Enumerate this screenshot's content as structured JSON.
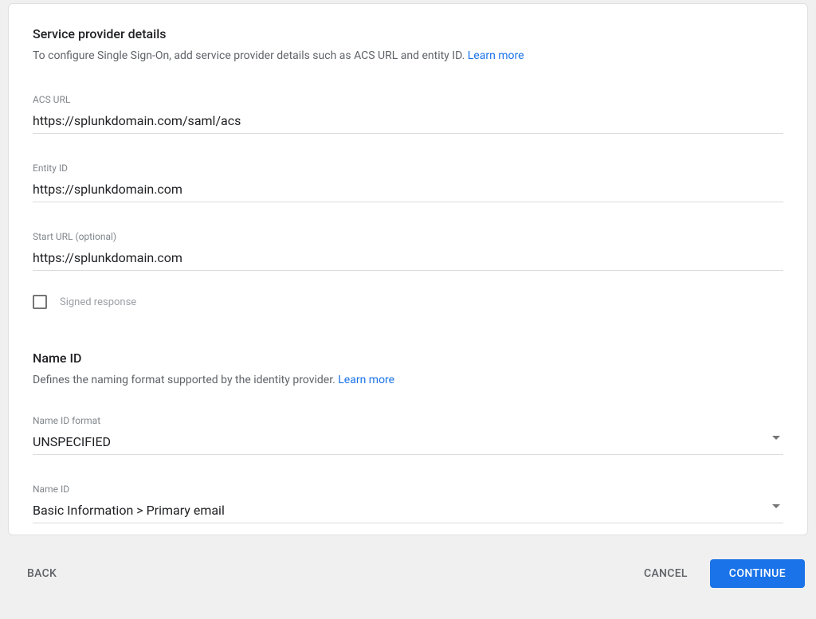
{
  "section1": {
    "title": "Service provider details",
    "desc": "To configure Single Sign-On, add service provider details such as ACS URL and entity ID. ",
    "learn_more": "Learn more"
  },
  "fields": {
    "acs_label": "ACS URL",
    "acs_value": "https://splunkdomain.com/saml/acs",
    "entity_label": "Entity ID",
    "entity_value": "https://splunkdomain.com",
    "start_label": "Start URL (optional)",
    "start_value": "https://splunkdomain.com",
    "signed_label": "Signed response"
  },
  "section2": {
    "title": "Name ID",
    "desc": "Defines the naming format supported by the identity provider. ",
    "learn_more": "Learn more"
  },
  "selects": {
    "format_label": "Name ID format",
    "format_value": "UNSPECIFIED",
    "nameid_label": "Name ID",
    "nameid_value": "Basic Information > Primary email"
  },
  "footer": {
    "back": "BACK",
    "cancel": "CANCEL",
    "continue": "CONTINUE"
  }
}
